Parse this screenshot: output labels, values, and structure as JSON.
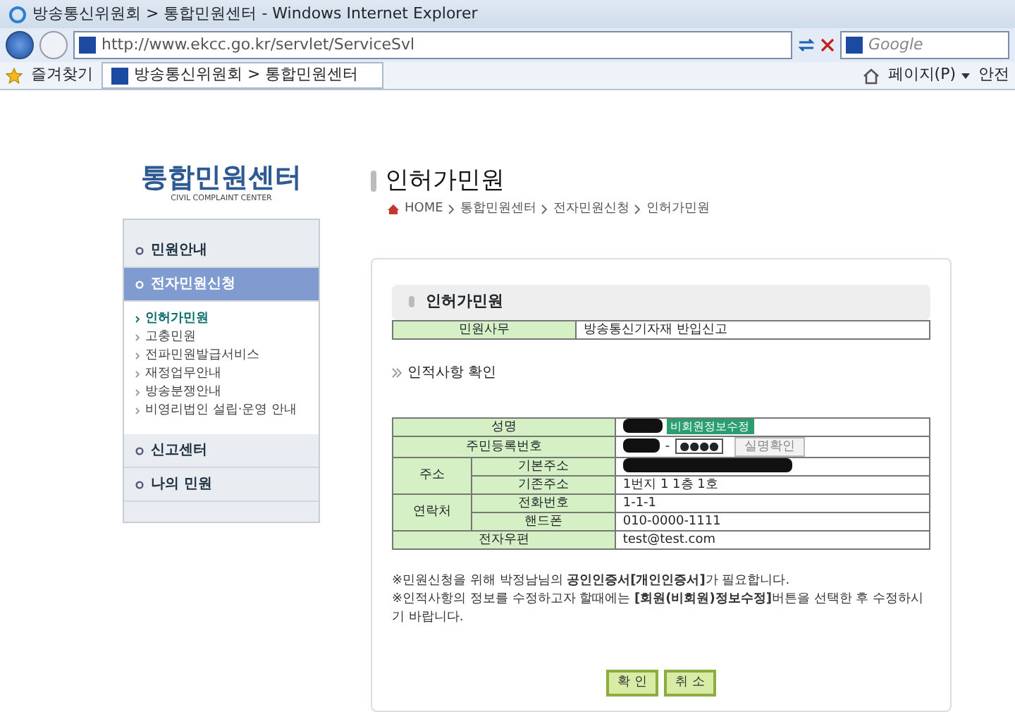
{
  "window": {
    "title": "방송통신위원회 > 통합민원센터 - Windows Internet Explorer"
  },
  "address_bar": {
    "url": "http://www.ekcc.go.kr/servlet/ServiceSvl",
    "search_placeholder": "Google"
  },
  "favorites_bar": {
    "favorites": "즐겨찾기",
    "tab": "방송통신위원회 > 통합민원센터",
    "page_menu": "페이지(P)",
    "safety_menu": "안전"
  },
  "sidebar": {
    "logo": "통합민원센터",
    "logo_subtitle": "CIVIL COMPLAINT CENTER",
    "items": [
      {
        "label": "민원안내",
        "selected": false
      },
      {
        "label": "전자민원신청",
        "selected": true,
        "children": [
          {
            "label": "인허가민원",
            "selected": true
          },
          {
            "label": "고충민원",
            "selected": false
          },
          {
            "label": "전파민원발급서비스",
            "selected": false
          },
          {
            "label": "재정업무안내",
            "selected": false
          },
          {
            "label": "방송분쟁안내",
            "selected": false
          },
          {
            "label": "비영리법인 설립·운영 안내",
            "selected": false
          }
        ]
      },
      {
        "label": "신고센터",
        "selected": false
      },
      {
        "label": "나의 민원",
        "selected": false
      }
    ]
  },
  "page": {
    "title": "인허가민원",
    "breadcrumb": [
      "HOME",
      "통합민원센터",
      "전자민원신청",
      "인허가민원"
    ]
  },
  "panel": {
    "section_title": "인허가민원",
    "summary": {
      "label": "민원사무",
      "value": "방송통신기자재 반입신고"
    },
    "subheading": "인적사항 확인",
    "form": {
      "name_label": "성명",
      "name_redacted": true,
      "edit_button": "비회원정보수정",
      "rrn_label": "주민등록번호",
      "rrn_redacted": true,
      "rrn_separator": "-",
      "rrn_masked": "●●●●",
      "verify_button": "실명확인",
      "address_label": "주소",
      "address_rows": [
        {
          "label": "기본주소",
          "redacted": true
        },
        {
          "label": "기존주소",
          "redacted": false,
          "value": "1번지 1 1층 1호"
        }
      ],
      "contact_label": "연락처",
      "contact_rows": [
        {
          "label": "전화번호",
          "redacted": false,
          "value": "1-1-1"
        },
        {
          "label": "핸드폰",
          "redacted": false,
          "value": "010-0000-1111"
        }
      ],
      "email_label": "전자우편",
      "email": "test@test.com"
    },
    "notes": [
      "※민원신청을 위해 박정남님의 **공인인증서[개인인증서]**가 필요합니다.",
      "※인적사항의 정보를 수정하고자 할때에는 **[회원(비회원)정보수정]**버튼을 선택한 후 수정하시기 바랍니다."
    ],
    "buttons": [
      "확 인",
      "취 소"
    ]
  }
}
